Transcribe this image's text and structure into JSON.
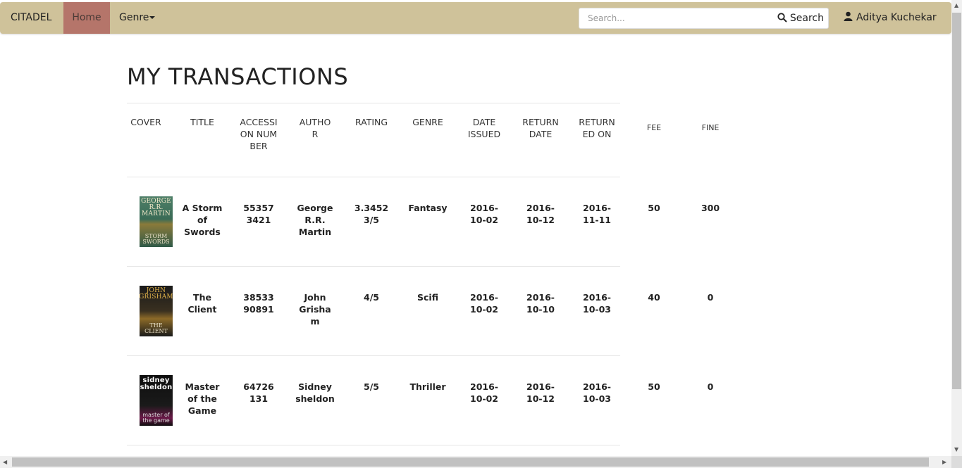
{
  "nav": {
    "brand": "CITADEL",
    "home": "Home",
    "genre": "Genre",
    "search_placeholder": "Search...",
    "search_button": "Search",
    "user": "Aditya Kuchekar"
  },
  "page": {
    "title": "MY TRANSACTIONS"
  },
  "table": {
    "headers": [
      "COVER",
      "TITLE",
      "ACCESSION NUMBER",
      "AUTHOR",
      "RATING",
      "GENRE",
      "DATE ISSUED",
      "RETURN DATE",
      "RETURNED ON",
      "FEE",
      "FINE"
    ],
    "rows": [
      {
        "cover_top": "GEORGE R.R. MARTIN",
        "cover_bottom": "STORM SWORDS",
        "title": "A Storm of Swords",
        "accession": "553573421",
        "author": "George R.R. Martin",
        "rating": "3.34523/5",
        "genre": "Fantasy",
        "date_issued": "2016-10-02",
        "return_date": "2016-10-12",
        "returned_on": "2016-11-11",
        "fee": "50",
        "fine": "300"
      },
      {
        "cover_top": "JOHN GRISHAM",
        "cover_bottom": "THE CLIENT",
        "title": "The Client",
        "accession": "3853390891",
        "author": "John Grisham",
        "rating": "4/5",
        "genre": "Scifi",
        "date_issued": "2016-10-02",
        "return_date": "2016-10-10",
        "returned_on": "2016-10-03",
        "fee": "40",
        "fine": "0"
      },
      {
        "cover_top": "sidney sheldon",
        "cover_bottom": "master of the game",
        "title": "Master of the Game",
        "accession": "64726131",
        "author": "Sidney sheldon",
        "rating": "5/5",
        "genre": "Thriller",
        "date_issued": "2016-10-02",
        "return_date": "2016-10-12",
        "returned_on": "2016-10-03",
        "fee": "50",
        "fine": "0"
      }
    ]
  }
}
